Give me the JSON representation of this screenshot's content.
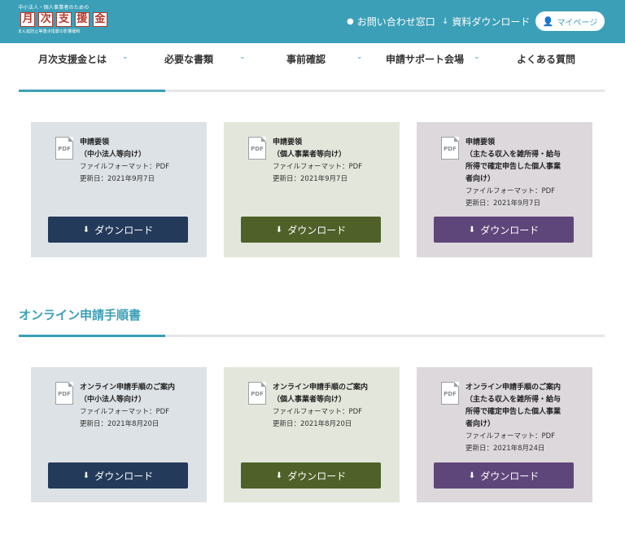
{
  "header": {
    "logo_top": "中小法人・個人事業者のための",
    "logo_chars": [
      "月",
      "次",
      "支",
      "援",
      "金"
    ],
    "logo_bottom": "まん延防止等重点措置の影響緩和",
    "inquiry": "お問い合わせ窓口",
    "download": "資料ダウンロード",
    "mypage": "マイページ",
    "icons": {
      "inquiry": "chat-bubble-icon",
      "download": "download-arrow-icon",
      "mypage": "user-icon"
    }
  },
  "nav": {
    "items": [
      {
        "label": "月次支援金とは",
        "has_dropdown": true
      },
      {
        "label": "必要な書類",
        "has_dropdown": true
      },
      {
        "label": "事前確認",
        "has_dropdown": true
      },
      {
        "label": "申請サポート会場",
        "has_dropdown": true
      },
      {
        "label": "よくある質問",
        "has_dropdown": false
      }
    ]
  },
  "sections": [
    {
      "title": "",
      "cards": [
        {
          "color": "blue",
          "title1": "申請要領",
          "title2": "（中小法人等向け）",
          "title3": "",
          "title4": "",
          "format": "ファイルフォーマット：PDF",
          "updated": "更新日：2021年9月7日",
          "button": "ダウンロード"
        },
        {
          "color": "green",
          "title1": "申請要領",
          "title2": "（個人事業者等向け）",
          "title3": "",
          "title4": "",
          "format": "ファイルフォーマット：PDF",
          "updated": "更新日：2021年9月7日",
          "button": "ダウンロード"
        },
        {
          "color": "purple",
          "title1": "申請要領",
          "title2": "（主たる収入を雑所得・給与",
          "title3": "所得で確定申告した個人事業",
          "title4": "者向け）",
          "format": "ファイルフォーマット：PDF",
          "updated": "更新日：2021年9月7日",
          "button": "ダウンロード"
        }
      ]
    },
    {
      "title": "オンライン申請手順書",
      "cards": [
        {
          "color": "blue",
          "title1": "オンライン申請手順のご案内",
          "title2": "（中小法人等向け）",
          "title3": "",
          "title4": "",
          "format": "ファイルフォーマット：PDF",
          "updated": "更新日：2021年8月20日",
          "button": "ダウンロード"
        },
        {
          "color": "green",
          "title1": "オンライン申請手順のご案内",
          "title2": "（個人事業者等向け）",
          "title3": "",
          "title4": "",
          "format": "ファイルフォーマット：PDF",
          "updated": "更新日：2021年8月20日",
          "button": "ダウンロード"
        },
        {
          "color": "purple",
          "title1": "オンライン申請手順のご案内",
          "title2": "（主たる収入を雑所得・給与",
          "title3": "所得で確定申告した個人事業",
          "title4": "者向け）",
          "format": "ファイルフォーマット：PDF",
          "updated": "更新日：2021年8月24日",
          "button": "ダウンロード"
        }
      ]
    }
  ],
  "pdf_label": "PDF",
  "colors": {
    "header": "#3b9fb8",
    "blue_button": "#243a5a",
    "green_button": "#4f6128",
    "purple_button": "#5f467a"
  }
}
